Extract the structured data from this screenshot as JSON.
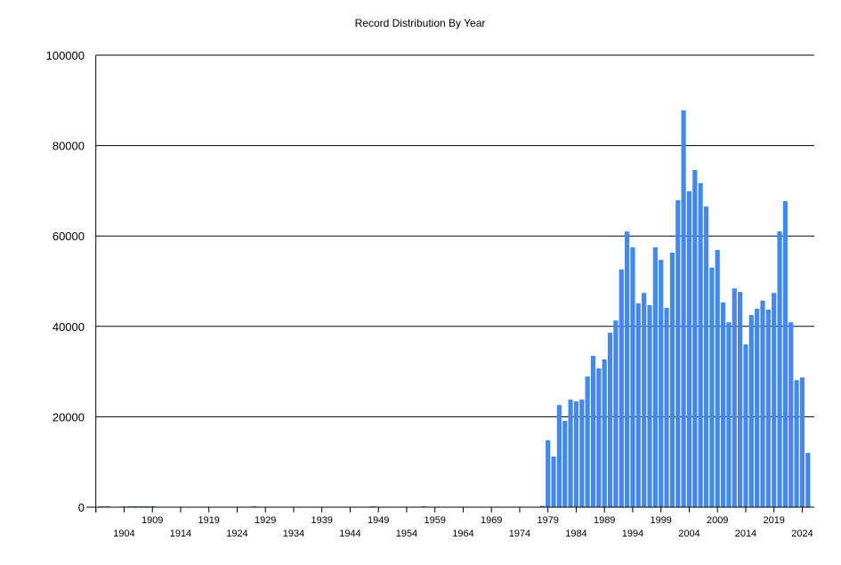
{
  "chart_data": {
    "type": "bar",
    "title": "Record Distribution By Year",
    "xlabel": "",
    "ylabel": "",
    "ylim": [
      0,
      100000
    ],
    "yticks": [
      0,
      20000,
      40000,
      60000,
      80000,
      100000
    ],
    "xlim": [
      1899,
      2025
    ],
    "xtick_step": 5,
    "xtick_labels": [
      "1904",
      "1909",
      "1914",
      "1919",
      "1924",
      "1929",
      "1934",
      "1939",
      "1944",
      "1949",
      "1954",
      "1959",
      "1964",
      "1969",
      "1974",
      "1979",
      "1984",
      "1989",
      "1994",
      "1999",
      "2004",
      "2009",
      "2014",
      "2019",
      "2024"
    ],
    "grid": true,
    "legend": "none",
    "bar_color": "#4388EC",
    "points": [
      [
        1900,
        200
      ],
      [
        1901,
        200
      ],
      [
        1904,
        150
      ],
      [
        1905,
        200
      ],
      [
        1906,
        200
      ],
      [
        1907,
        200
      ],
      [
        1908,
        200
      ],
      [
        1909,
        200
      ],
      [
        1927,
        200
      ],
      [
        1948,
        200
      ],
      [
        1957,
        200
      ],
      [
        1978,
        300
      ],
      [
        1979,
        14800
      ],
      [
        1980,
        11200
      ],
      [
        1981,
        22600
      ],
      [
        1982,
        19100
      ],
      [
        1983,
        23800
      ],
      [
        1984,
        23400
      ],
      [
        1985,
        23800
      ],
      [
        1986,
        28900
      ],
      [
        1987,
        33500
      ],
      [
        1988,
        30700
      ],
      [
        1989,
        32700
      ],
      [
        1990,
        38600
      ],
      [
        1991,
        41300
      ],
      [
        1992,
        52600
      ],
      [
        1993,
        61000
      ],
      [
        1994,
        57500
      ],
      [
        1995,
        45100
      ],
      [
        1996,
        47400
      ],
      [
        1997,
        44700
      ],
      [
        1998,
        57500
      ],
      [
        1999,
        54700
      ],
      [
        2000,
        44100
      ],
      [
        2001,
        56300
      ],
      [
        2002,
        67900
      ],
      [
        2003,
        87800
      ],
      [
        2004,
        69900
      ],
      [
        2005,
        74600
      ],
      [
        2006,
        71700
      ],
      [
        2007,
        66500
      ],
      [
        2008,
        53000
      ],
      [
        2009,
        56900
      ],
      [
        2010,
        45300
      ],
      [
        2011,
        40900
      ],
      [
        2012,
        48400
      ],
      [
        2013,
        47600
      ],
      [
        2014,
        36000
      ],
      [
        2015,
        42500
      ],
      [
        2016,
        43900
      ],
      [
        2017,
        45700
      ],
      [
        2018,
        43700
      ],
      [
        2019,
        47400
      ],
      [
        2020,
        61000
      ],
      [
        2021,
        67700
      ],
      [
        2022,
        40900
      ],
      [
        2023,
        28100
      ],
      [
        2024,
        28700
      ],
      [
        2025,
        12000
      ]
    ]
  }
}
